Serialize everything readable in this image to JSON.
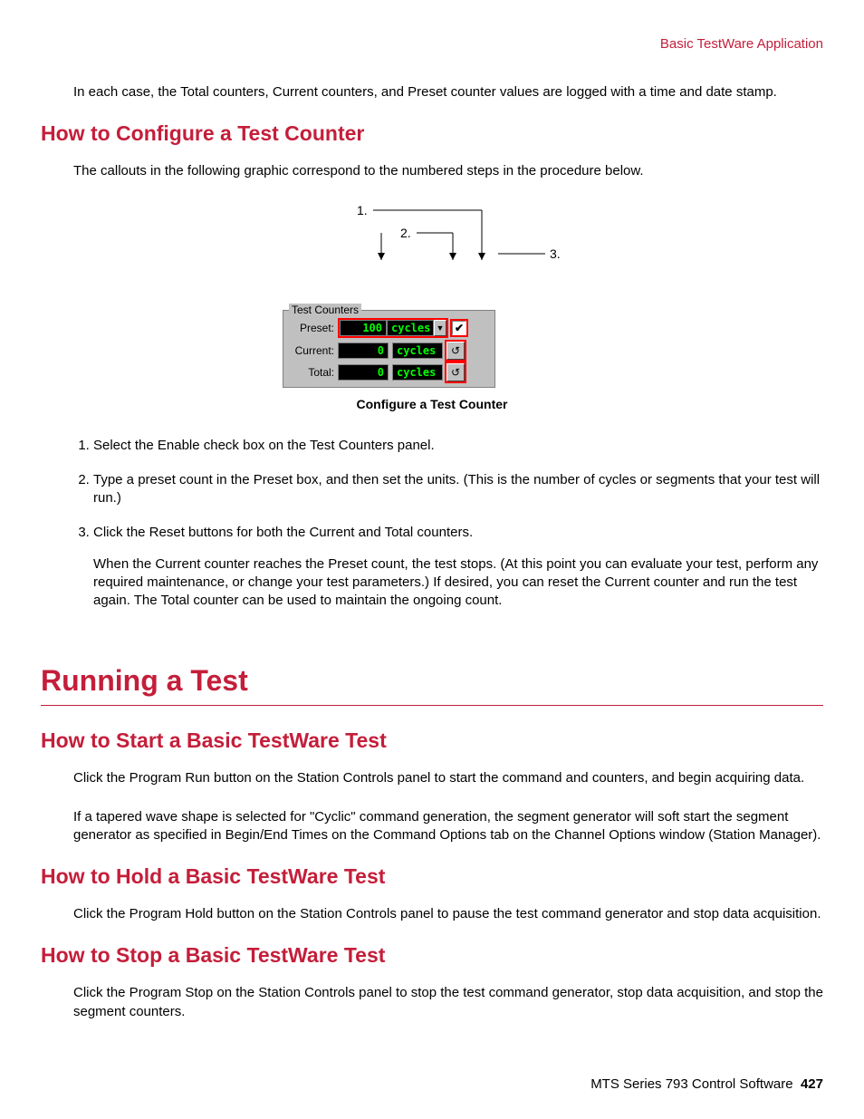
{
  "header": {
    "breadcrumb": "Basic TestWare Application"
  },
  "intro": {
    "p1": "In each case, the Total counters, Current counters, and Preset counter values are logged with a time and date stamp."
  },
  "section_configure": {
    "title": "How to Configure a Test Counter",
    "p1": "The callouts in the following graphic correspond to the numbered steps in the procedure below.",
    "figure": {
      "callouts": {
        "c1": "1.",
        "c2": "2.",
        "c3": "3."
      },
      "panel": {
        "legend": "Test Counters",
        "rows": {
          "preset": {
            "label": "Preset:",
            "value": "100",
            "unit": "cycles"
          },
          "current": {
            "label": "Current:",
            "value": "0",
            "unit": "cycles"
          },
          "total": {
            "label": "Total:",
            "value": "0",
            "unit": "cycles"
          }
        },
        "checkbox_mark": "☑",
        "dropdown_arrow": "▼",
        "reset_glyph": "↺"
      },
      "caption": "Configure a Test Counter"
    },
    "steps": {
      "s1": "Select the Enable check box on the Test Counters panel.",
      "s2": "Type a preset count in the Preset box, and then set the units. (This is the number of cycles or segments that your test will run.)",
      "s3": "Click the Reset buttons for both the Current and Total counters.",
      "s3_sub": "When the Current counter reaches the Preset count, the test stops. (At this point you can evaluate your test, perform any required maintenance, or change your test parameters.) If desired, you can reset the Current counter and run the test again. The Total counter can be used to maintain the ongoing count."
    }
  },
  "section_running": {
    "title": "Running a Test",
    "start": {
      "title": "How to Start a Basic TestWare Test",
      "p1": "Click the Program Run button on the Station Controls panel to start the command and counters, and begin acquiring data.",
      "p2": "If a tapered wave shape is selected for \"Cyclic\" command generation, the segment generator will soft start the segment generator as specified in Begin/End Times on the Command Options tab on the Channel Options window (Station Manager)."
    },
    "hold": {
      "title": "How to Hold a Basic TestWare Test",
      "p1": "Click the Program Hold button on the Station Controls panel to pause the test command generator and stop data acquisition."
    },
    "stop": {
      "title": "How to Stop a Basic TestWare Test",
      "p1": "Click the Program Stop on the Station Controls panel to stop the test command generator, stop data acquisition, and stop the segment counters."
    }
  },
  "footer": {
    "product": "MTS Series 793 Control Software",
    "page": "427"
  }
}
